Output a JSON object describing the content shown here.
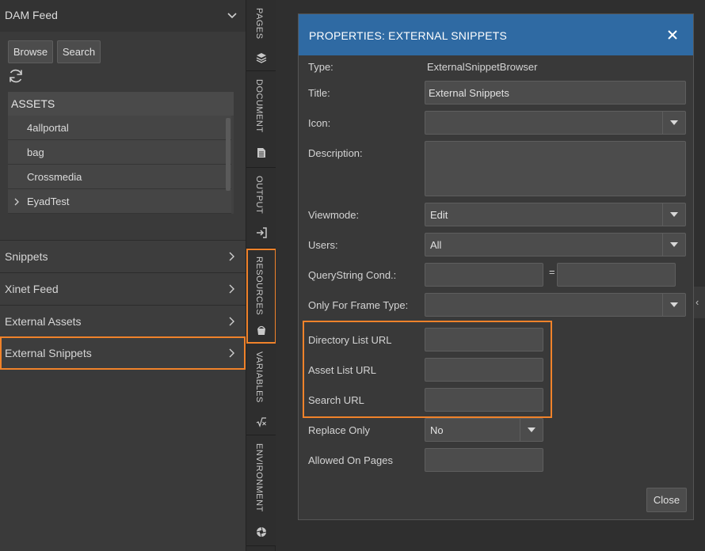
{
  "left_panel": {
    "dam_feed_title": "DAM Feed",
    "browse_label": "Browse",
    "search_label": "Search",
    "assets_header": "ASSETS",
    "assets": [
      {
        "label": "4allportal"
      },
      {
        "label": "bag"
      },
      {
        "label": "Crossmedia"
      },
      {
        "label": "EyadTest"
      }
    ],
    "sections": [
      {
        "label": "Snippets"
      },
      {
        "label": "Xinet Feed"
      },
      {
        "label": "External Assets"
      },
      {
        "label": "External Snippets"
      }
    ]
  },
  "tab_strip": {
    "tabs": [
      {
        "label": "PAGES",
        "icon": "layers-icon"
      },
      {
        "label": "DOCUMENT",
        "icon": "document-icon"
      },
      {
        "label": "OUTPUT",
        "icon": "export-icon"
      },
      {
        "label": "RESOURCES",
        "icon": "bucket-icon"
      },
      {
        "label": "VARIABLES",
        "icon": "function-icon"
      },
      {
        "label": "ENVIRONMENT",
        "icon": "aperture-icon"
      }
    ]
  },
  "dialog": {
    "title": "PROPERTIES: EXTERNAL SNIPPETS",
    "type_label": "Type:",
    "type_value": "ExternalSnippetBrowser",
    "title_label": "Title:",
    "title_value": "External Snippets",
    "icon_label": "Icon:",
    "icon_value": "",
    "description_label": "Description:",
    "description_value": "",
    "viewmode_label": "Viewmode:",
    "viewmode_value": "Edit",
    "users_label": "Users:",
    "users_value": "All",
    "querystring_label": "QueryString Cond.:",
    "querystring_left": "",
    "querystring_eq": "=",
    "querystring_right": "",
    "frame_type_label": "Only For Frame Type:",
    "frame_type_value": "",
    "directory_url_label": "Directory List URL",
    "directory_url_value": "",
    "asset_url_label": "Asset List URL",
    "asset_url_value": "",
    "search_url_label": "Search URL",
    "search_url_value": "",
    "replace_only_label": "Replace Only",
    "replace_only_value": "No",
    "allowed_pages_label": "Allowed On Pages",
    "allowed_pages_value": "",
    "close_label": "Close"
  },
  "colors": {
    "accent_highlight": "#f0822a",
    "dialog_header": "#2f6aa3"
  }
}
